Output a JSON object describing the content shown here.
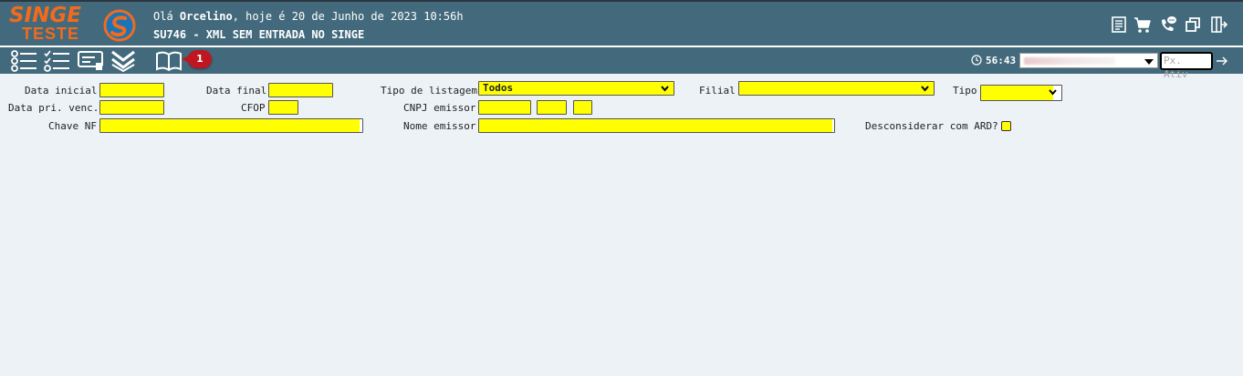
{
  "header": {
    "logo_top": "SINGE",
    "logo_bottom": "TESTE",
    "greeting_prefix": "Olá ",
    "user_name": "Orcelino",
    "greeting_suffix": ", hoje é 20 de Junho de 2023 10:56h",
    "screen_title": "SU746 - XML SEM ENTRADA NO SINGE",
    "icons": [
      "document-icon",
      "cart-icon",
      "phone-chat-icon",
      "window-restore-icon",
      "logout-icon"
    ]
  },
  "toolbar": {
    "icons": [
      "list-icon",
      "checklist-icon",
      "form-icon",
      "double-chevron-down-icon",
      "book-icon"
    ],
    "badge": "1",
    "timer": "56:43",
    "px_ativ_placeholder": "Px. Ativ"
  },
  "form": {
    "data_inicial_label": "Data inicial",
    "data_final_label": "Data final",
    "tipo_listagem_label": "Tipo de listagem",
    "tipo_listagem_value": "Todos",
    "filial_label": "Filial",
    "filial_value": "",
    "tipo_label": "Tipo",
    "tipo_value": "",
    "data_pri_venc_label": "Data pri. venc.",
    "cfop_label": "CFOP",
    "cnpj_emissor_label": "CNPJ emissor",
    "chave_nf_label": "Chave NF",
    "nome_emissor_label": "Nome emissor",
    "desconsiderar_label": "Desconsiderar com ARD?"
  },
  "colors": {
    "header_bg": "#436a7c",
    "page_bg": "#edf2f7",
    "field_bg": "#ffff00",
    "logo": "#f26b1d",
    "badge": "#c0161f"
  }
}
